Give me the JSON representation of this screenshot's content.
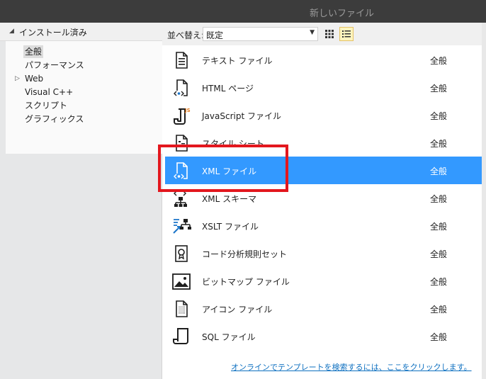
{
  "window": {
    "title": "新しいファイル"
  },
  "left_pane": {
    "section_label": "インストール済み",
    "tree": [
      {
        "label": "全般",
        "selected": true
      },
      {
        "label": "パフォーマンス"
      },
      {
        "label": "Web",
        "expandable": true
      },
      {
        "label": "Visual C++"
      },
      {
        "label": "スクリプト"
      },
      {
        "label": "グラフィックス"
      }
    ]
  },
  "toolbar": {
    "sort_label": "並べ替え:",
    "sort_value": "既定"
  },
  "templates": [
    {
      "name": "テキスト ファイル",
      "category": "全般",
      "icon": "text-file-icon"
    },
    {
      "name": "HTML ページ",
      "category": "全般",
      "icon": "html-page-icon"
    },
    {
      "name": "JavaScript ファイル",
      "category": "全般",
      "icon": "javascript-file-icon"
    },
    {
      "name": "スタイル シート",
      "category": "全般",
      "icon": "stylesheet-icon"
    },
    {
      "name": "XML ファイル",
      "category": "全般",
      "icon": "xml-file-icon",
      "selected": true
    },
    {
      "name": "XML スキーマ",
      "category": "全般",
      "icon": "xml-schema-icon"
    },
    {
      "name": "XSLT ファイル",
      "category": "全般",
      "icon": "xslt-file-icon"
    },
    {
      "name": "コード分析規則セット",
      "category": "全般",
      "icon": "ruleset-icon"
    },
    {
      "name": "ビットマップ ファイル",
      "category": "全般",
      "icon": "bitmap-icon"
    },
    {
      "name": "アイコン ファイル",
      "category": "全般",
      "icon": "icon-file-icon"
    },
    {
      "name": "SQL ファイル",
      "category": "全般",
      "icon": "sql-file-icon"
    }
  ],
  "online_link": "オンラインでテンプレートを検索するには、ここをクリックします。",
  "colors": {
    "selection": "#3399ff",
    "highlight_box": "#e3171e",
    "link": "#0e70c0"
  }
}
